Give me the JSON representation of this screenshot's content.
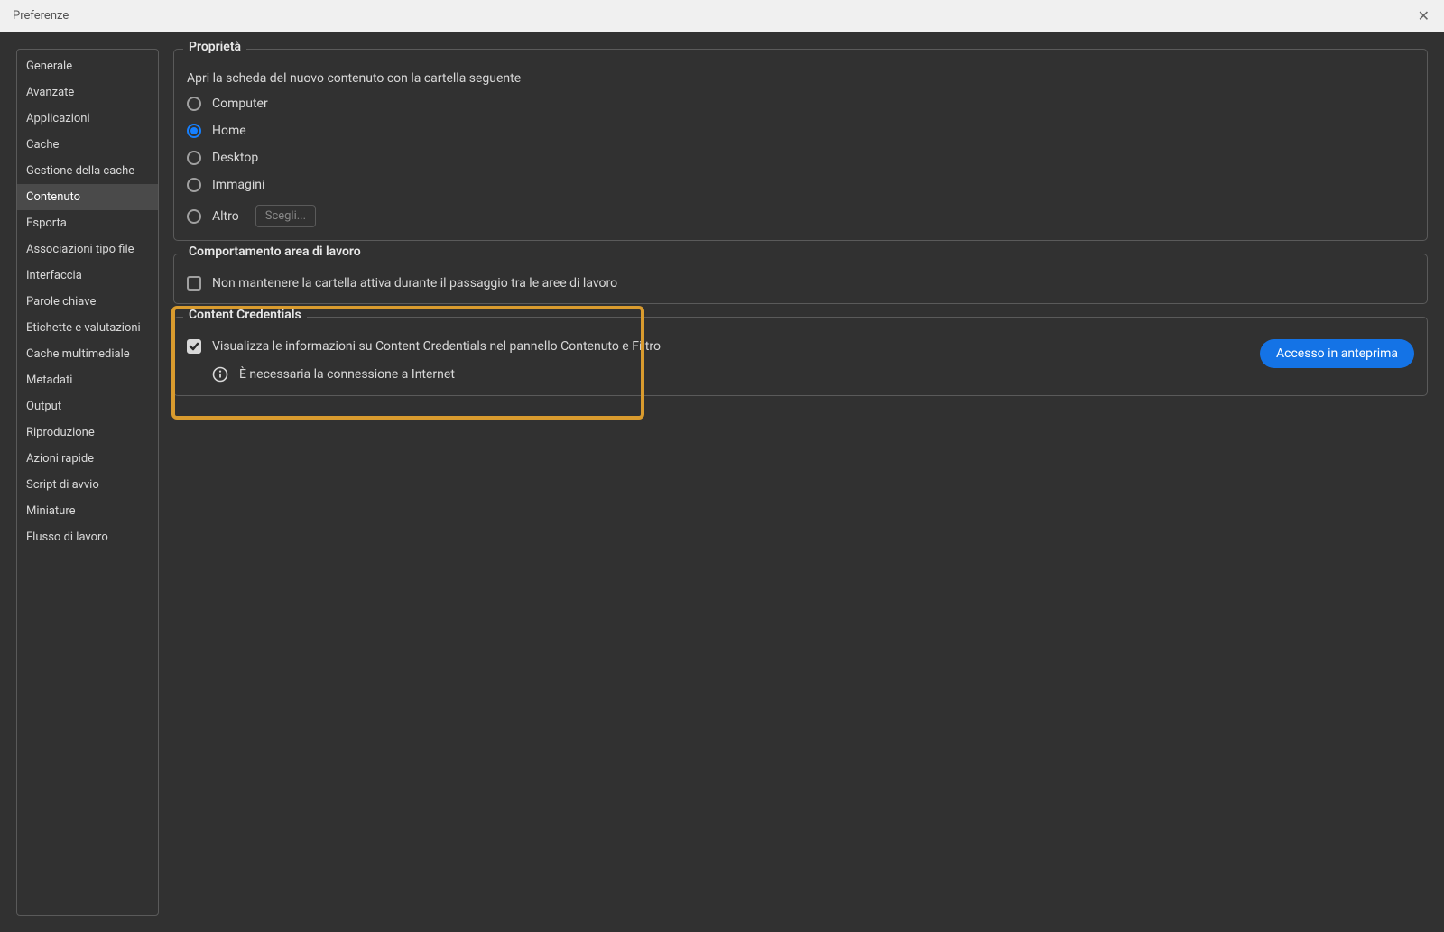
{
  "window": {
    "title": "Preferenze"
  },
  "sidebar": {
    "items": [
      {
        "label": "Generale",
        "selected": false
      },
      {
        "label": "Avanzate",
        "selected": false
      },
      {
        "label": "Applicazioni",
        "selected": false
      },
      {
        "label": "Cache",
        "selected": false
      },
      {
        "label": "Gestione della cache",
        "selected": false
      },
      {
        "label": "Contenuto",
        "selected": true
      },
      {
        "label": "Esporta",
        "selected": false
      },
      {
        "label": "Associazioni tipo file",
        "selected": false
      },
      {
        "label": "Interfaccia",
        "selected": false
      },
      {
        "label": "Parole chiave",
        "selected": false
      },
      {
        "label": "Etichette e valutazioni",
        "selected": false
      },
      {
        "label": "Cache multimediale",
        "selected": false
      },
      {
        "label": "Metadati",
        "selected": false
      },
      {
        "label": "Output",
        "selected": false
      },
      {
        "label": "Riproduzione",
        "selected": false
      },
      {
        "label": "Azioni rapide",
        "selected": false
      },
      {
        "label": "Script di avvio",
        "selected": false
      },
      {
        "label": "Miniature",
        "selected": false
      },
      {
        "label": "Flusso di lavoro",
        "selected": false
      }
    ]
  },
  "properties": {
    "title": "Proprietà",
    "subtitle": "Apri la scheda del nuovo contenuto con la cartella seguente",
    "options": [
      {
        "label": "Computer",
        "selected": false
      },
      {
        "label": "Home",
        "selected": true
      },
      {
        "label": "Desktop",
        "selected": false
      },
      {
        "label": "Immagini",
        "selected": false
      },
      {
        "label": "Altro",
        "selected": false
      }
    ],
    "browse_label": "Scegli..."
  },
  "workspace": {
    "title": "Comportamento area di lavoro",
    "checkbox_label": "Non mantenere la cartella attiva durante il passaggio tra le aree di lavoro",
    "checked": false
  },
  "content_credentials": {
    "title": "Content Credentials",
    "checkbox_label": "Visualizza le informazioni su Content Credentials nel pannello Contenuto e Filtro",
    "checked": true,
    "info_text": "È necessaria la connessione a Internet",
    "button_label": "Accesso in anteprima"
  }
}
